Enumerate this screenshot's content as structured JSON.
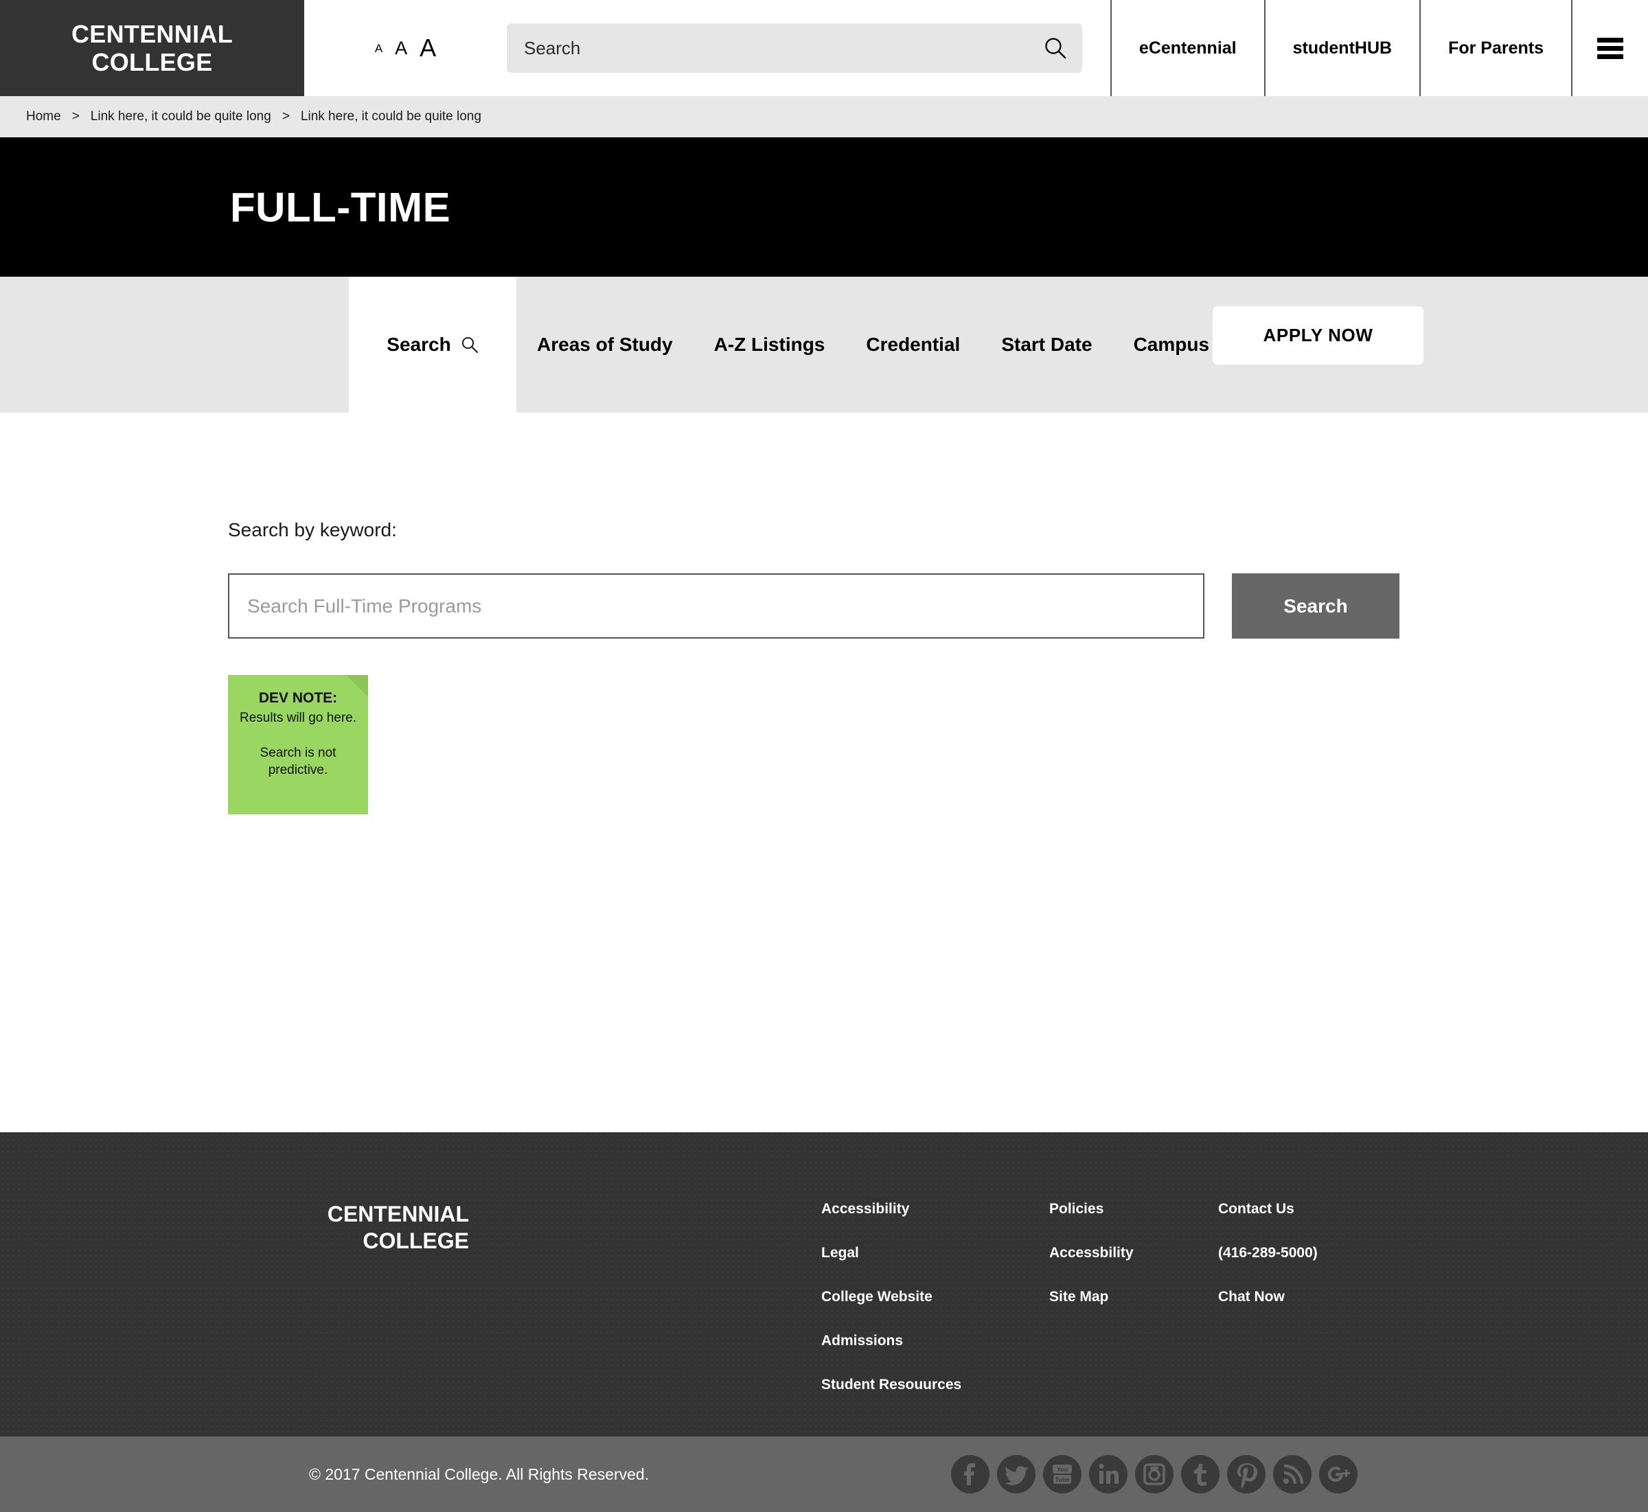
{
  "header": {
    "logo_line1": "CENTENNIAL",
    "logo_line2": "COLLEGE",
    "fontsize": {
      "small": "A",
      "medium": "A",
      "large": "A"
    },
    "search_placeholder": "Search",
    "search_value": "",
    "search_icon": "search-icon",
    "nav": [
      {
        "label": "eCentennial"
      },
      {
        "label": "studentHUB"
      },
      {
        "label": "For Parents"
      }
    ],
    "menu_icon": "hamburger-icon"
  },
  "breadcrumb": {
    "items": [
      "Home",
      "Link here, it could be quite long",
      "Link here, it could be quite long"
    ],
    "separator": ">"
  },
  "hero": {
    "title": "FULL-TIME",
    "apply_label": "APPLY NOW"
  },
  "tabs": [
    {
      "label": "Search",
      "active": true,
      "icon": "magnifier-icon"
    },
    {
      "label": "Areas of Study",
      "active": false
    },
    {
      "label": "A-Z Listings",
      "active": false
    },
    {
      "label": "Credential",
      "active": false
    },
    {
      "label": "Start Date",
      "active": false
    },
    {
      "label": "Campus",
      "active": false
    }
  ],
  "main": {
    "keyword_label": "Search by keyword:",
    "keyword_placeholder": "Search Full-Time Programs",
    "keyword_value": "",
    "search_button": "Search",
    "devnote": {
      "title": "DEV NOTE:",
      "line1": "Results will go here.",
      "line2": "Search is not predictive."
    }
  },
  "footer": {
    "logo_line1": "CENTENNIAL",
    "logo_line2": "COLLEGE",
    "col1": [
      "Accessibility",
      "Legal",
      "College Website",
      "Admissions",
      "Student Resouurces"
    ],
    "col2": [
      "Policies",
      "Accessbility",
      "Site Map"
    ],
    "col3": [
      "Contact Us",
      "(416-289-5000)",
      "Chat Now"
    ],
    "copyright": "© 2017 Centennial College. All Rights Reserved.",
    "socials": [
      "facebook-icon",
      "twitter-icon",
      "youtube-icon",
      "linkedin-icon",
      "instagram-icon",
      "tumblr-icon",
      "pinterest-icon",
      "rss-icon",
      "googleplus-icon"
    ]
  },
  "colors": {
    "logo_bg": "#333333",
    "hero_bg": "#000000",
    "breadcrumb_bg": "#e8e8e8",
    "tabbar_bg": "#e6e6e6",
    "footer_bg": "#333333",
    "bottombar_bg": "#666666",
    "button_gray": "#666666",
    "devnote_green": "#99d762"
  }
}
